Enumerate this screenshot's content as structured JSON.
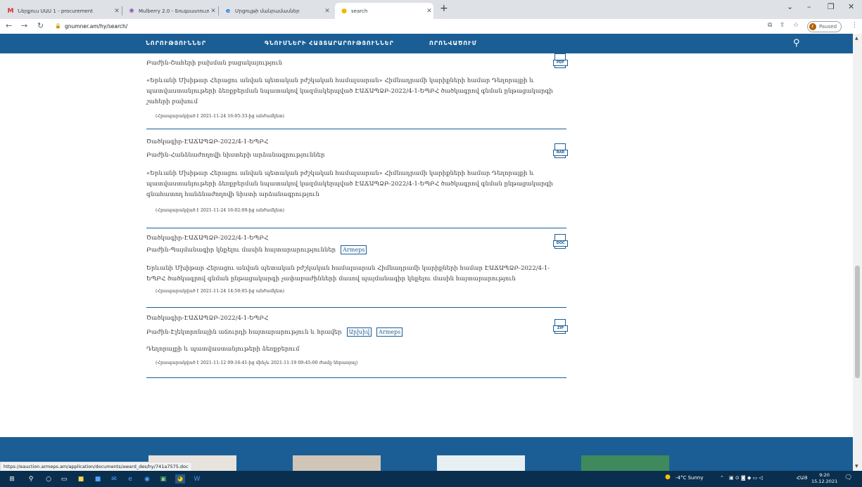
{
  "browser": {
    "tabs": [
      {
        "label": "Ներքուս ՍԱՍ 1 - procurement",
        "icon": "gmail-icon",
        "active": false
      },
      {
        "label": "Mulberry 2.0 - Տուգսատ‍ուտտ",
        "icon": "mulberry-icon",
        "active": false
      },
      {
        "label": "Մրցույթի մանրամասներ",
        "icon": "edge-icon",
        "active": false
      },
      {
        "label": "search",
        "icon": "site-icon",
        "active": true
      }
    ],
    "url": "gnumner.am/hy/search/",
    "profile_label": "Paused",
    "profile_initial": "F"
  },
  "nav": {
    "items": [
      "ՆՈՐՈՒԹՅՈՒՆՆԵՐ",
      "ԳՆՈՒՄՆԵՐԻ ՀԱՅՏԱՐԱՐՈՒԹՅՈՒՆՆԵՐ",
      "ՈՐՈՆՎԱԾՈՒՄ"
    ]
  },
  "results": [
    {
      "title": "",
      "file_label": "Բաժին-Շահերի բախման բացակայություն",
      "file_type": "PDF",
      "tags": [],
      "description": "«Երևանի Մխիթար Հերացու անվան պետական բժշկական համալսարան» Հիմնադրամի կարիքների համար Դեղորայքի և պատվաստանյութերի ձեռքբերման նպատակով կազմակերպված ԷԱՃԱՊՁԲ-2022/4-1-ԵՊԲՀ ծածկագրով գնման ընթացակարգի շահերի բախում",
      "date": "(Հրապարակված է 2021-11-24 16:05:33-ից անժամկետ)"
    },
    {
      "title": "Ծածկագիր-ԷԱՃԱՊՁԲ-2022/4-1-ԵՊԲՀ",
      "file_label": "Բաժին-Հանձնաժողովի նիստերի արձանագրություններ",
      "file_type": "RAR",
      "tags": [],
      "description": "«Երևանի Մխիթար Հերացու անվան պետական բժշկական համալսարան» Հիմնադրամի կարիքների համար Դեղորայքի և պատվաստանյութերի ձեռքբերման նպատակով կազմակերպված ԷԱՃԱՊՁԲ-2022/4-1-ԵՊԲՀ ծածկագրով գնման ընթացակարգի գնահատող հանձնաժողովի նիստի արձանագրություն",
      "date": "(Հրապարակված է 2021-11-24 16:02:09-ից անժամկետ)"
    },
    {
      "title": "Ծածկագիր-ԷԱՃԱՊՁԲ-2022/4-1-ԵՊԲՀ",
      "file_label": "Բաժին-Պայմանագիր կնքելու մասին հայտարարություններ",
      "file_type": "DOC",
      "tags": [
        "Armeps"
      ],
      "description": "Երևանի Մխիթար Հերացու անվան պետական բժշկական համալսարան Հիմնադրամի կարիքների համար ԷԱՃԱՊՁԲ-2022/4-1-ԵՊԲՀ ծածկագրով գնման ընթացակարգի չափաբաժինների մասով պայմանագիր կնքելու մասին հայտարարություն",
      "date": "(Հրապարակված է 2021-11-24 14:50:05-ից անժամկետ)"
    },
    {
      "title": "Ծածկագիր-ԷԱՃԱՊՁԲ-2022/4-1-ԵՊԲՀ",
      "file_label": "Բաժին-Էլեկտրոնային աճուրդի հայտարարություն և հրավեր",
      "file_type": "ZIP",
      "tags": [
        "Արխիվ",
        "Armeps"
      ],
      "description": "Դեղորայքի և պատվաստանյութերի ձեռքբերում",
      "date": "(Հրապարակված է 2021-11-12 09:16:41-ից մինչև 2021-11-19 09:45:00 ժամը ներառյալ)"
    }
  ],
  "status_url": "https://eauction.armeps.am/application/documents/award_des/hy/741a7575.doc",
  "taskbar": {
    "weather": "-4°C  Sunny",
    "lang": "ՀԱՅ",
    "time": "9:20",
    "date": "15.12.2021"
  },
  "colors": {
    "brand": "#1b5e95",
    "taskbar": "#0a2f4e"
  }
}
